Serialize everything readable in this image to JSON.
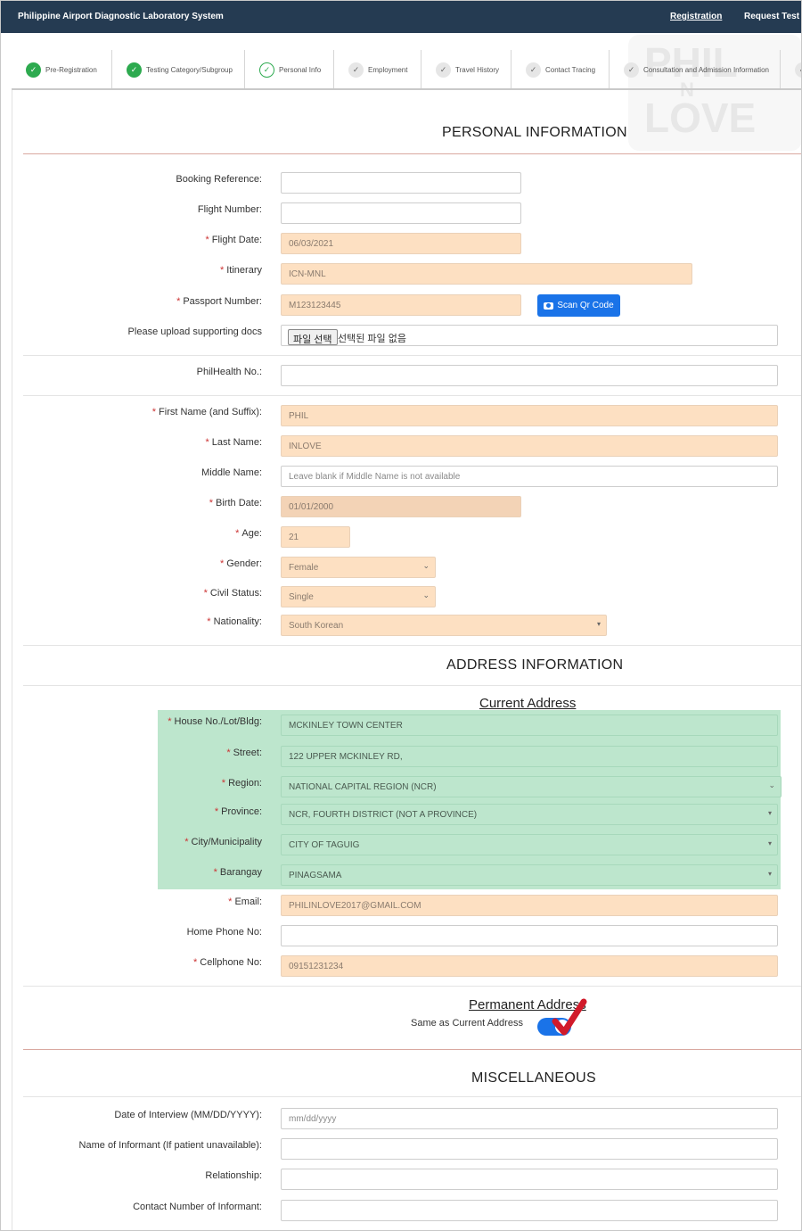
{
  "header": {
    "title": "Philippine Airport Diagnostic Laboratory System",
    "nav_registration": "Registration",
    "nav_request": "Request Test In"
  },
  "steps": [
    {
      "label": "Pre-Registration",
      "status": "done"
    },
    {
      "label": "Testing Category/Subgroup",
      "status": "done"
    },
    {
      "label": "Personal Info",
      "status": "current"
    },
    {
      "label": "Employment",
      "status": "todo"
    },
    {
      "label": "Travel History",
      "status": "todo"
    },
    {
      "label": "Contact Tracing",
      "status": "todo"
    },
    {
      "label": "Consultation and Admission Information",
      "status": "todo"
    }
  ],
  "watermark": {
    "line1": "PHIL",
    "line2": "N",
    "line3": "LOVE"
  },
  "sections": {
    "personal": "PERSONAL INFORMATION",
    "address": "ADDRESS INFORMATION",
    "current_address": "Current Address",
    "permanent_address": "Permanent Address",
    "misc": "MISCELLANEOUS"
  },
  "personal": {
    "booking_ref": {
      "label": "Booking Reference:",
      "value": ""
    },
    "flight_number": {
      "label": "Flight Number:",
      "value": ""
    },
    "flight_date": {
      "label": "Flight Date:",
      "value": "06/03/2021"
    },
    "itinerary": {
      "label": "Itinerary",
      "value": "ICN-MNL"
    },
    "passport": {
      "label": "Passport Number:",
      "value": "M123123445"
    },
    "scan_button": "Scan Qr Code",
    "upload": {
      "label": "Please upload supporting docs",
      "button": "파일 선택",
      "status": "선택된 파일 없음"
    },
    "philhealth": {
      "label": "PhilHealth No.:",
      "value": ""
    },
    "first_name": {
      "label": "First Name (and Suffix):",
      "value": "PHIL"
    },
    "last_name": {
      "label": "Last Name:",
      "value": "INLOVE"
    },
    "middle_name": {
      "label": "Middle Name:",
      "placeholder": "Leave blank if Middle Name is not available"
    },
    "birth_date": {
      "label": "Birth Date:",
      "value": "01/01/2000"
    },
    "age": {
      "label": "Age:",
      "value": "21"
    },
    "gender": {
      "label": "Gender:",
      "value": "Female"
    },
    "civil_status": {
      "label": "Civil Status:",
      "value": "Single"
    },
    "nationality": {
      "label": "Nationality:",
      "value": "South Korean"
    }
  },
  "address": {
    "house": {
      "label": "House No./Lot/Bldg:",
      "value": "MCKINLEY TOWN CENTER"
    },
    "street": {
      "label": "Street:",
      "value": "122 UPPER MCKINLEY RD,"
    },
    "region": {
      "label": "Region:",
      "value": "NATIONAL CAPITAL REGION (NCR)"
    },
    "province": {
      "label": "Province:",
      "value": "NCR, FOURTH DISTRICT (NOT A PROVINCE)"
    },
    "city": {
      "label": "City/Municipality",
      "value": "CITY OF TAGUIG"
    },
    "barangay": {
      "label": "Barangay",
      "value": "PINAGSAMA"
    },
    "email": {
      "label": "Email:",
      "value": "PHILINLOVE2017@GMAIL.COM"
    },
    "home_phone": {
      "label": "Home Phone No:",
      "value": ""
    },
    "cellphone": {
      "label": "Cellphone No:",
      "value": "09151231234"
    },
    "same_as_current": "Same as Current Address"
  },
  "misc": {
    "interview_date": {
      "label": "Date of Interview (MM/DD/YYYY):",
      "placeholder": "mm/dd/yyyy"
    },
    "informant_name": {
      "label": "Name of Informant (If patient unavailable):",
      "value": ""
    },
    "relationship": {
      "label": "Relationship:",
      "value": ""
    },
    "informant_contact": {
      "label": "Contact Number of Informant:",
      "value": ""
    }
  },
  "colors": {
    "header_bg": "#253b52",
    "required_fill": "#fde0c2",
    "address_fill": "#bde6cd",
    "primary": "#1a73e8",
    "done": "#2daa4f"
  }
}
